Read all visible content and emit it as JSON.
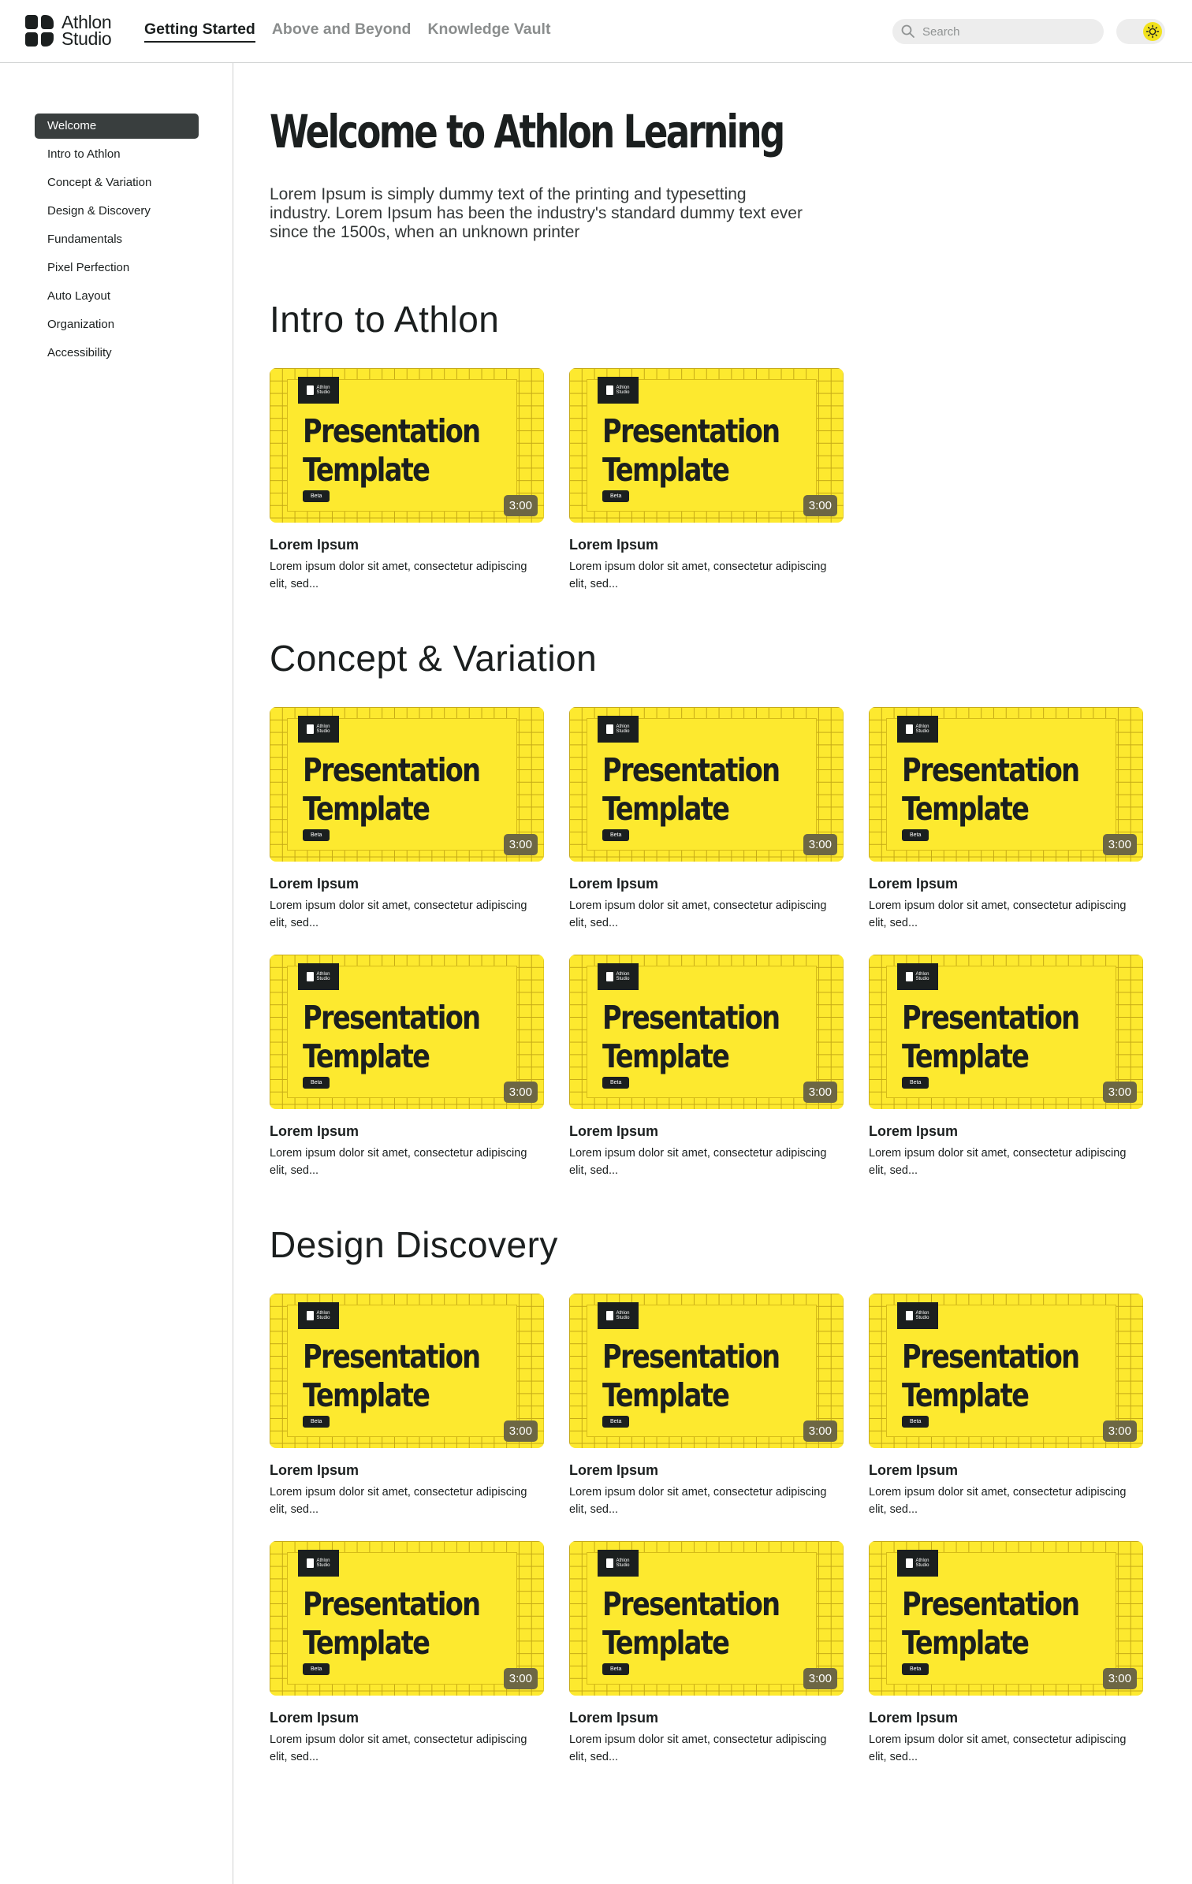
{
  "header": {
    "logo_line1": "Athlon",
    "logo_line2": "Studio",
    "nav": [
      "Getting Started",
      "Above and Beyond",
      "Knowledge Vault"
    ],
    "active_nav": "Getting Started",
    "search_placeholder": "Search"
  },
  "sidebar": {
    "items": [
      "Welcome",
      "Intro to Athlon",
      "Concept & Variation",
      "Design & Discovery",
      "Fundamentals",
      "Pixel Perfection",
      "Auto Layout",
      "Organization",
      "Accessibility"
    ],
    "active": "Welcome"
  },
  "hero": {
    "title": "Welcome to Athlon Learning",
    "description": "Lorem Ipsum is simply dummy text of the printing and typesetting industry. Lorem Ipsum has been the industry's standard dummy text ever since the 1500s, when an unknown printer"
  },
  "thumbnail": {
    "logo_text_1": "Athlon",
    "logo_text_2": "Studio",
    "title_line1": "Presentation",
    "title_line2": "Template",
    "badge": "Beta"
  },
  "sections": [
    {
      "title": "Intro to Athlon",
      "cards": [
        {
          "title": "Lorem Ipsum",
          "description": "Lorem ipsum dolor sit amet, consectetur adipiscing elit, sed...",
          "duration": "3:00"
        },
        {
          "title": "Lorem Ipsum",
          "description": "Lorem ipsum dolor sit amet, consectetur adipiscing elit, sed...",
          "duration": "3:00"
        }
      ]
    },
    {
      "title": "Concept & Variation",
      "cards": [
        {
          "title": "Lorem Ipsum",
          "description": "Lorem ipsum dolor sit amet, consectetur adipiscing elit, sed...",
          "duration": "3:00"
        },
        {
          "title": "Lorem Ipsum",
          "description": "Lorem ipsum dolor sit amet, consectetur adipiscing elit, sed...",
          "duration": "3:00"
        },
        {
          "title": "Lorem Ipsum",
          "description": "Lorem ipsum dolor sit amet, consectetur adipiscing elit, sed...",
          "duration": "3:00"
        },
        {
          "title": "Lorem Ipsum",
          "description": "Lorem ipsum dolor sit amet, consectetur adipiscing elit, sed...",
          "duration": "3:00"
        },
        {
          "title": "Lorem Ipsum",
          "description": "Lorem ipsum dolor sit amet, consectetur adipiscing elit, sed...",
          "duration": "3:00"
        },
        {
          "title": "Lorem Ipsum",
          "description": "Lorem ipsum dolor sit amet, consectetur adipiscing elit, sed...",
          "duration": "3:00"
        }
      ]
    },
    {
      "title": "Design Discovery",
      "cards": [
        {
          "title": "Lorem Ipsum",
          "description": "Lorem ipsum dolor sit amet, consectetur adipiscing elit, sed...",
          "duration": "3:00"
        },
        {
          "title": "Lorem Ipsum",
          "description": "Lorem ipsum dolor sit amet, consectetur adipiscing elit, sed...",
          "duration": "3:00"
        },
        {
          "title": "Lorem Ipsum",
          "description": "Lorem ipsum dolor sit amet, consectetur adipiscing elit, sed...",
          "duration": "3:00"
        },
        {
          "title": "Lorem Ipsum",
          "description": "Lorem ipsum dolor sit amet, consectetur adipiscing elit, sed...",
          "duration": "3:00"
        },
        {
          "title": "Lorem Ipsum",
          "description": "Lorem ipsum dolor sit amet, consectetur adipiscing elit, sed...",
          "duration": "3:00"
        },
        {
          "title": "Lorem Ipsum",
          "description": "Lorem ipsum dolor sit amet, consectetur adipiscing elit, sed...",
          "duration": "3:00"
        }
      ]
    }
  ],
  "colors": {
    "accent_yellow": "#fde92f",
    "dark": "#1b1f1f",
    "sidebar_active": "#393e3e",
    "duration_badge": "#6d6744"
  },
  "icons": {
    "search": "search-icon",
    "theme_toggle": "sun-icon",
    "logo": "athlon-logo-icon"
  }
}
